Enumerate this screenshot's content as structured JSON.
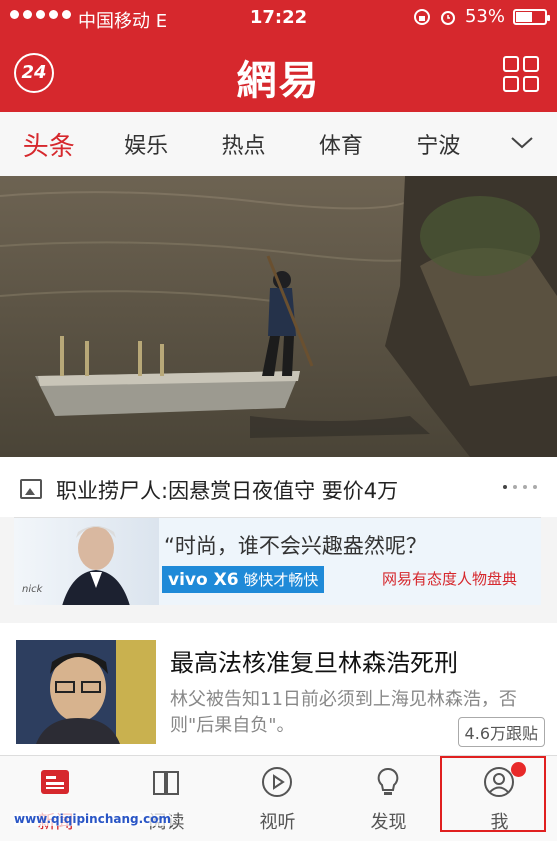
{
  "status_bar": {
    "carrier": "中国移动  E",
    "time": "17:22",
    "battery": "53%",
    "battery_level": 0.53
  },
  "header": {
    "logo": "網易",
    "left_badge": "24",
    "left_icon": "news-24h-icon",
    "right_icon": "grid-menu-icon"
  },
  "tabs": [
    {
      "label": "头条",
      "active": true
    },
    {
      "label": "娱乐"
    },
    {
      "label": "热点"
    },
    {
      "label": "体育"
    },
    {
      "label": "宁波"
    }
  ],
  "tabs_more_icon": "chevron-down-icon",
  "hero": {
    "caption": "职业捞尸人:因悬赏日夜值守 要价4万",
    "caption_icon": "image-icon",
    "pages": 4,
    "current_page": 1
  },
  "ad": {
    "slogan": "“时尚，谁不会兴趣盎然呢？",
    "vivo_label": "vivo X6",
    "vivo_tagline": "够快才畅快",
    "brand": "网易有态度人物盘典",
    "nick": "nick"
  },
  "news": {
    "title": "最高法核准复旦林森浩死刑",
    "desc": "林父被告知11日前必须到上海见林森浩，否则\"后果自负\"。",
    "follow": "4.6万跟贴"
  },
  "bottom_nav": [
    {
      "label": "新闻",
      "icon": "news-icon",
      "active": true
    },
    {
      "label": "阅读",
      "icon": "book-icon"
    },
    {
      "label": "视听",
      "icon": "play-icon"
    },
    {
      "label": "发现",
      "icon": "lightbulb-icon"
    },
    {
      "label": "我",
      "icon": "user-icon",
      "badge": true
    }
  ],
  "watermark": "www.qiqipinchang.com",
  "colors": {
    "brand": "#d6282d"
  }
}
